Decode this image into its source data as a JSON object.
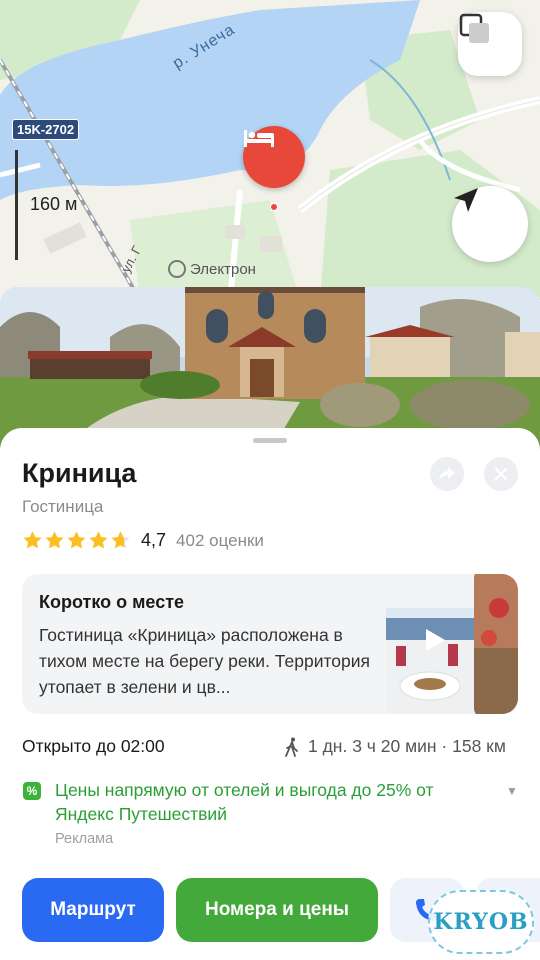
{
  "map": {
    "road_badge": "15K-2702",
    "scale": "160 м",
    "river_label": "р. Унеча",
    "street_label": "ул. Г",
    "poi_label": "Электрон",
    "colors": {
      "water": "#b3d4f5",
      "land": "#f2f1ea",
      "green": "#cfe8c4",
      "pin": "#e8483a"
    }
  },
  "place": {
    "title": "Криница",
    "category": "Гостиница",
    "rating_value": "4,7",
    "rating_stars": 4.7,
    "rating_count": "402 оценки"
  },
  "about": {
    "title": "Коротко о месте",
    "text": "Гостиница «Криница» расположена в тихом месте на берегу реки. Территория утопает в зелени и цв..."
  },
  "status": {
    "hours": "Открыто до 02:00",
    "walk": "1 дн. 3 ч 20 мин · 158 км"
  },
  "promo": {
    "badge": "%",
    "text": "Цены напрямую от отелей и выгода до 25% от Яндекс Путешествий",
    "ad_label": "Реклама"
  },
  "actions": {
    "route": "Маршрут",
    "rooms": "Номера и цены"
  },
  "watermark": "KRYOB",
  "colors": {
    "route_button": "#2a6af3",
    "rooms_button": "#43a93a",
    "promo_text": "#2a9f35"
  }
}
